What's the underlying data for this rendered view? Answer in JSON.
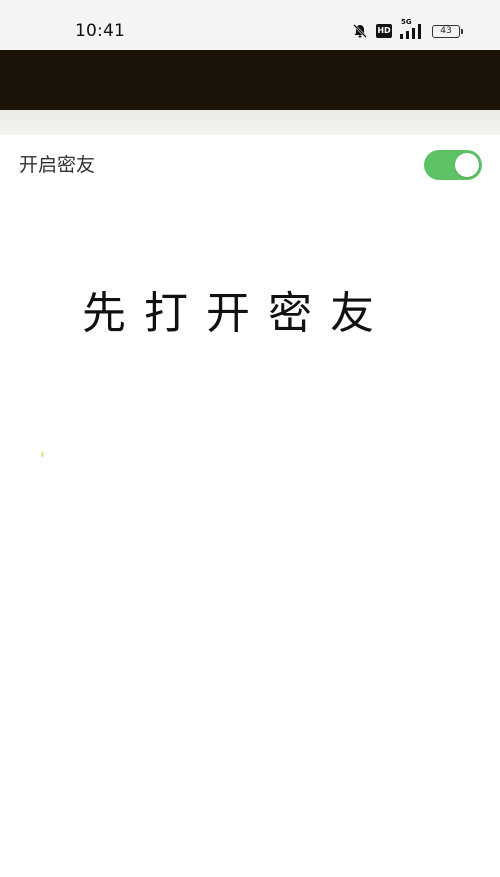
{
  "status_bar": {
    "time": "10:41",
    "network": "5G",
    "hd": "HD",
    "battery": "43",
    "icons": [
      "bell-off-icon",
      "hd-icon",
      "signal-5g-icon",
      "battery-icon"
    ]
  },
  "settings": {
    "enable_label": "开启密友",
    "enable_toggle_on": true,
    "accent_color": "#5dc265"
  },
  "main": {
    "hint_text": "先打开密友"
  }
}
